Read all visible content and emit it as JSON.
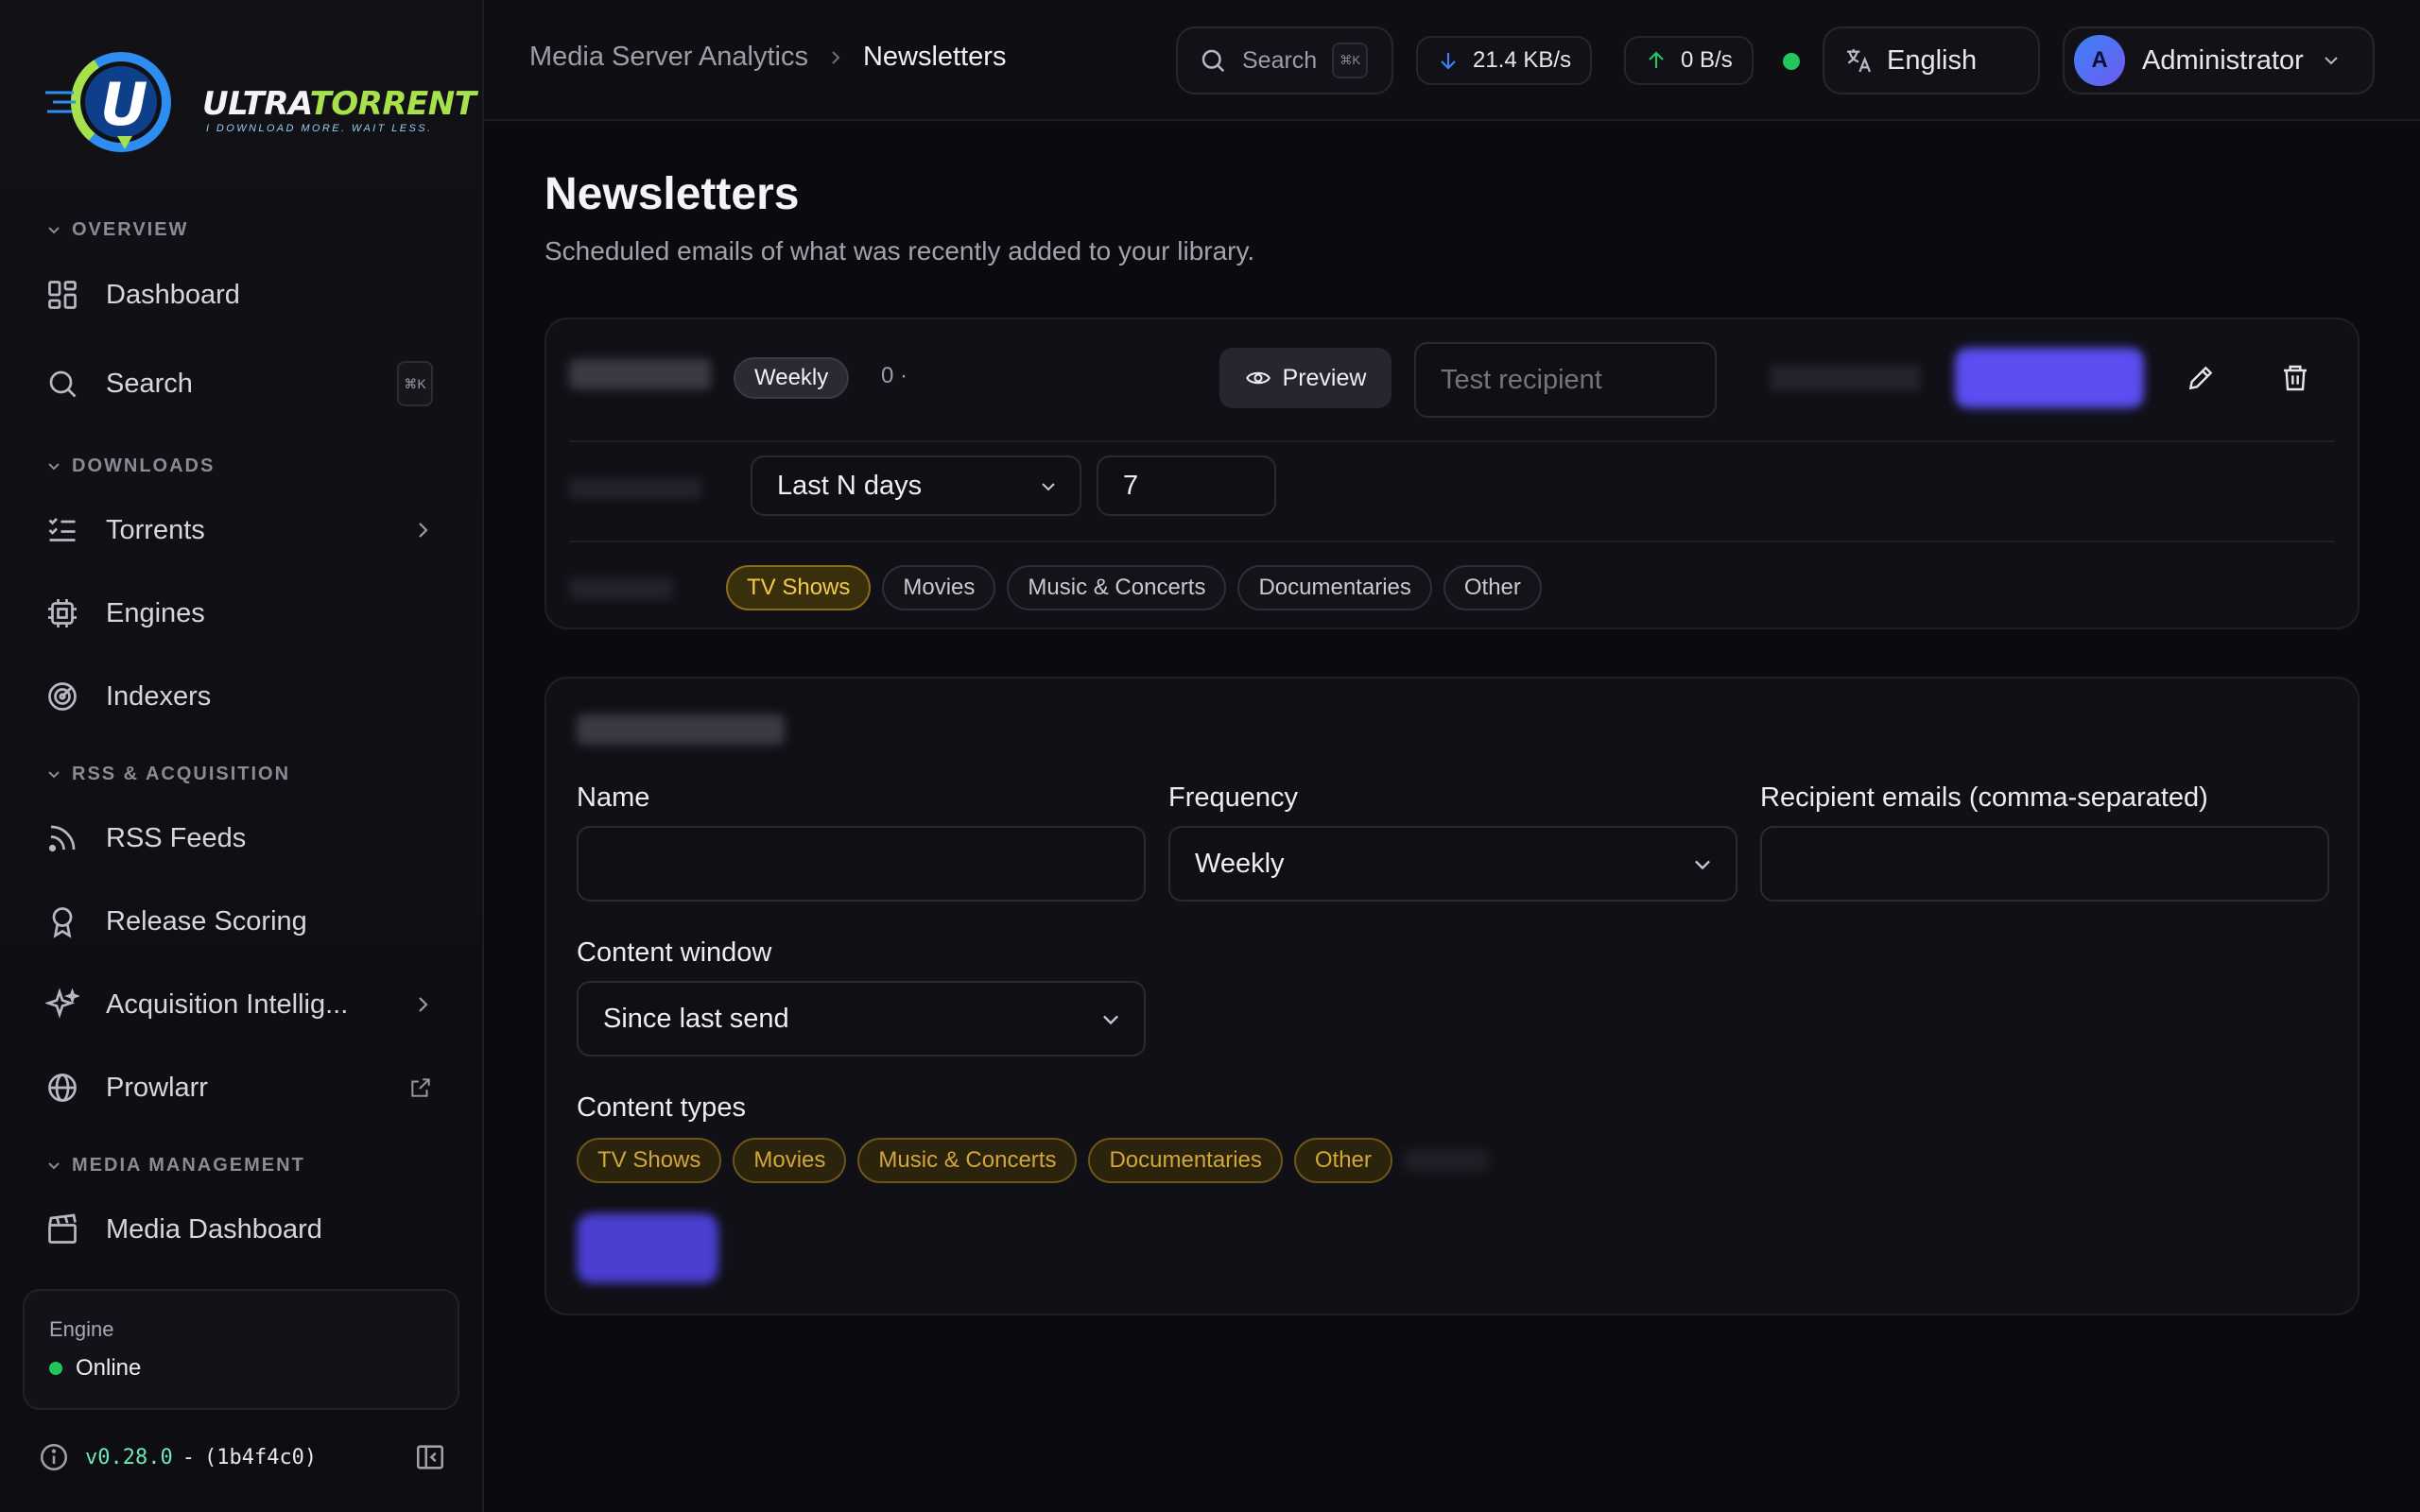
{
  "app": {
    "logo_name": "ULTRATORRENT",
    "logo_name_a": "ULTRA",
    "logo_name_b": "TORRENT",
    "logo_tagline": "I DOWNLOAD MORE. WAIT LESS."
  },
  "sidebar": {
    "sections": [
      {
        "label": "OVERVIEW"
      },
      {
        "label": "DOWNLOADS"
      },
      {
        "label": "RSS & ACQUISITION"
      },
      {
        "label": "MEDIA MANAGEMENT"
      }
    ],
    "items": [
      {
        "label": "Dashboard",
        "icon": "dashboard-icon"
      },
      {
        "label": "Search",
        "icon": "search-icon",
        "shortcut": "⌘K"
      },
      {
        "label": "Torrents",
        "icon": "list-icon"
      },
      {
        "label": "Engines",
        "icon": "chip-icon"
      },
      {
        "label": "Indexers",
        "icon": "radar-icon"
      },
      {
        "label": "RSS Feeds",
        "icon": "rss-icon"
      },
      {
        "label": "Release Scoring",
        "icon": "award-icon"
      },
      {
        "label": "Acquisition Intellig...",
        "icon": "sparkles-icon"
      },
      {
        "label": "Prowlarr",
        "icon": "globe-icon"
      },
      {
        "label": "Media Dashboard",
        "icon": "clapperboard-icon"
      }
    ],
    "engine": {
      "label": "Engine",
      "status": "Online"
    },
    "version": "v0.28.0",
    "version_sep": "-",
    "build": "(1b4f4c0)"
  },
  "topbar": {
    "breadcrumb": [
      "Media Server Analytics",
      "Newsletters"
    ],
    "search_label": "Search",
    "search_shortcut": "⌘K",
    "download_speed": "21.4 KB/s",
    "upload_speed": "0 B/s",
    "language": "English",
    "user_initial": "A",
    "user_name": "Administrator"
  },
  "page": {
    "title": "Newsletters",
    "subtitle": "Scheduled emails of what was recently added to your library."
  },
  "newsletter_card": {
    "frequency_badge": "Weekly",
    "count_text": "0 ·",
    "preview_label": "Preview",
    "test_recipient_placeholder": "Test recipient",
    "window_mode": "Last N days",
    "window_days": "7",
    "content_types": [
      "TV Shows",
      "Movies",
      "Music & Concerts",
      "Documentaries",
      "Other"
    ],
    "active_type": "TV Shows"
  },
  "new_form": {
    "name_label": "Name",
    "name_value": "",
    "frequency_label": "Frequency",
    "frequency_value": "Weekly",
    "recipients_label": "Recipient emails (comma-separated)",
    "recipients_value": "",
    "window_label": "Content window",
    "window_value": "Since last send",
    "types_label": "Content types",
    "content_types": [
      "TV Shows",
      "Movies",
      "Music & Concerts",
      "Documentaries",
      "Other"
    ]
  },
  "colors": {
    "accent_purple": "#5b4ef0",
    "active_gold": "#f3c94a",
    "online_green": "#22c55e",
    "version_green": "#6ee7b7"
  }
}
